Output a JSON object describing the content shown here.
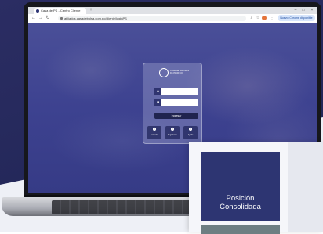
{
  "browser": {
    "tab_title": "Casa de PS - Centro Cliente",
    "new_tab": "+",
    "url": "afiliados.casadebolsa.com.ec/cliente/loginPS",
    "profile_pill": "Nuevo: Chrome disponible"
  },
  "login": {
    "brand_text": "CASA DE VALORES DE PACIFICO",
    "submit_label": "Ingresar",
    "quick_links": [
      {
        "label": "Consultar",
        "icon": "user-icon"
      },
      {
        "label": "Registrarse",
        "icon": "user-icon"
      },
      {
        "label": "Ayuda",
        "icon": "user-icon"
      }
    ]
  },
  "side_panel": {
    "tile_label_line1": "Posición",
    "tile_label_line2": "Consolidada"
  },
  "colors": {
    "dark_bg": "#2b2d63",
    "tile": "#2d3572",
    "page": "#3d4290"
  }
}
